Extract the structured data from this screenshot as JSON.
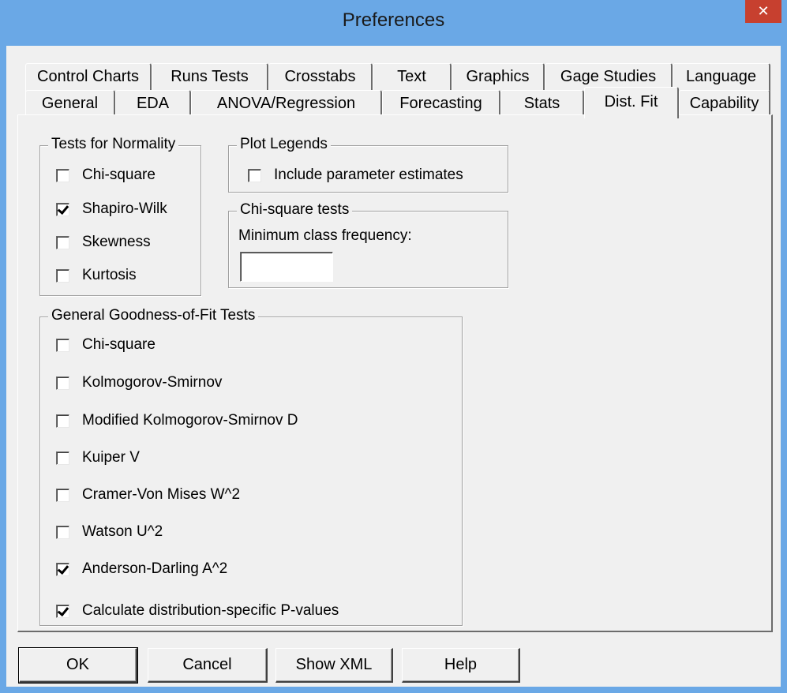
{
  "window": {
    "title": "Preferences",
    "close_glyph": "✕"
  },
  "tabs_row1": [
    {
      "label": "Control Charts"
    },
    {
      "label": "Runs Tests"
    },
    {
      "label": "Crosstabs"
    },
    {
      "label": "Text"
    },
    {
      "label": "Graphics"
    },
    {
      "label": "Gage Studies"
    },
    {
      "label": "Language"
    }
  ],
  "tabs_row2": [
    {
      "label": "General"
    },
    {
      "label": "EDA"
    },
    {
      "label": "ANOVA/Regression"
    },
    {
      "label": "Forecasting"
    },
    {
      "label": "Stats"
    },
    {
      "label": "Dist. Fit",
      "active": true
    },
    {
      "label": "Capability"
    }
  ],
  "normality": {
    "title": "Tests for Normality",
    "items": [
      {
        "label": "Chi-square",
        "checked": false
      },
      {
        "label": "Shapiro-Wilk",
        "checked": true
      },
      {
        "label": "Skewness",
        "checked": false
      },
      {
        "label": "Kurtosis",
        "checked": false
      }
    ]
  },
  "plot_legends": {
    "title": "Plot Legends",
    "include_label": "Include parameter estimates",
    "include_checked": false
  },
  "chi_square_tests": {
    "title": "Chi-square tests",
    "min_freq_label": "Minimum class frequency:",
    "min_freq_value": ""
  },
  "goodness_of_fit": {
    "title": "General Goodness-of-Fit Tests",
    "items": [
      {
        "label": "Chi-square",
        "checked": false
      },
      {
        "label": "Kolmogorov-Smirnov",
        "checked": false
      },
      {
        "label": "Modified Kolmogorov-Smirnov D",
        "checked": false
      },
      {
        "label": "Kuiper V",
        "checked": false
      },
      {
        "label": "Cramer-Von Mises W^2",
        "checked": false
      },
      {
        "label": "Watson U^2",
        "checked": false
      },
      {
        "label": "Anderson-Darling A^2",
        "checked": true
      }
    ],
    "calc_p_label": "Calculate distribution-specific P-values",
    "calc_p_checked": true
  },
  "buttons": {
    "ok": "OK",
    "cancel": "Cancel",
    "show_xml": "Show XML",
    "help": "Help"
  }
}
